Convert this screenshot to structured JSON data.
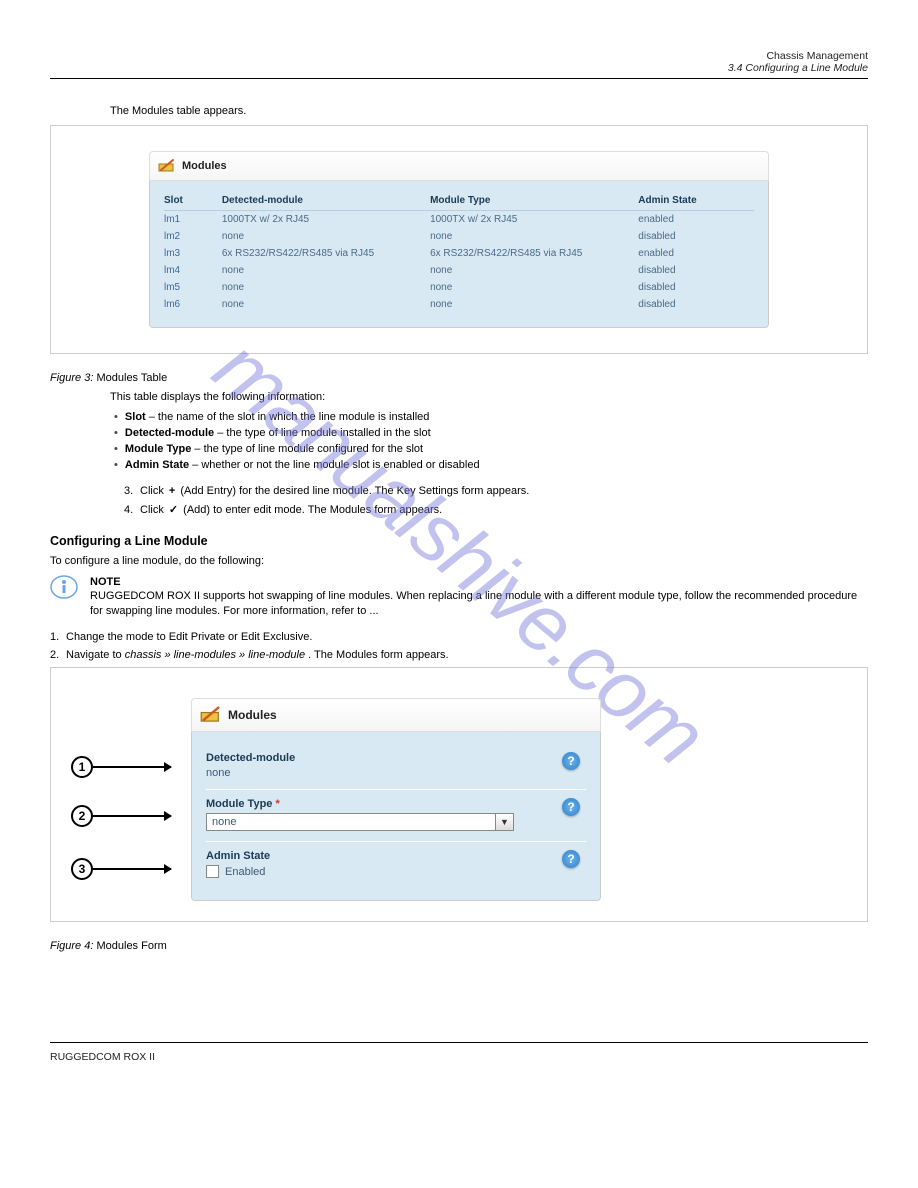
{
  "header": {
    "right_top": "Chassis Management",
    "right_line": "3.4 Configuring a Line Module"
  },
  "intro": "The Modules table appears.",
  "panel1": {
    "title": "Modules",
    "columns": [
      "Slot",
      "Detected-module",
      "Module Type",
      "Admin State"
    ],
    "rows": [
      {
        "slot": "lm1",
        "detected": "1000TX w/ 2x RJ45",
        "type": "1000TX w/ 2x RJ45",
        "state": "enabled"
      },
      {
        "slot": "lm2",
        "detected": "none",
        "type": "none",
        "state": "disabled"
      },
      {
        "slot": "lm3",
        "detected": "6x RS232/RS422/RS485 via RJ45",
        "type": "6x RS232/RS422/RS485 via RJ45",
        "state": "enabled"
      },
      {
        "slot": "lm4",
        "detected": "none",
        "type": "none",
        "state": "disabled"
      },
      {
        "slot": "lm5",
        "detected": "none",
        "type": "none",
        "state": "disabled"
      },
      {
        "slot": "lm6",
        "detected": "none",
        "type": "none",
        "state": "disabled"
      }
    ]
  },
  "figure1": {
    "label": "Figure 3:",
    "title": " Modules Table"
  },
  "desc1": "This table displays the following information:",
  "bullets": [
    {
      "label": "Slot",
      "text": " – the name of the slot in which the line module is installed"
    },
    {
      "label": "Detected-module",
      "text": " – the type of line module installed in the slot"
    },
    {
      "label": "Module Type",
      "text": " – the type of line module configured for the slot"
    },
    {
      "label": "Admin State",
      "text": " – whether or not the line module slot is enabled or disabled"
    }
  ],
  "steps": [
    {
      "n": "3.",
      "text_before": "Click ",
      "icon": "+",
      "text_after": " (Add Entry) for the desired line module. The Key Settings form appears."
    },
    {
      "n": "4.",
      "text_before": "Click ",
      "icon": "✓",
      "text_after": " (Add) to enter edit mode. The Modules form appears."
    }
  ],
  "section_heading": "Configuring a Line Module",
  "section_intro": "To configure a line module, do the following:",
  "note": {
    "head": "NOTE",
    "body": "RUGGEDCOM ROX II supports hot swapping of line modules. When replacing a line module with a different module type, follow the recommended procedure for swapping line modules. For more information, refer to ..."
  },
  "step_list": [
    {
      "n": "1.",
      "text": "Change the mode to Edit Private or Edit Exclusive."
    },
    {
      "n": "2.",
      "text_before": "Navigate to ",
      "path": "chassis » line-modules » line-module",
      "text_after": " . The Modules form appears."
    }
  ],
  "panel2": {
    "title": "Modules",
    "fields": {
      "detected_label": "Detected-module",
      "detected_value": "none",
      "moduletype_label": "Module Type",
      "moduletype_value": "none",
      "adminstate_label": "Admin State",
      "enabled_label": "Enabled"
    }
  },
  "callouts": [
    "1",
    "2",
    "3"
  ],
  "figure2": {
    "label": "Figure 4:",
    "title": " Modules Form"
  },
  "footer": {
    "left": "RUGGEDCOM ROX II",
    "center": "",
    "right": ""
  },
  "watermark": "manualshive.com"
}
